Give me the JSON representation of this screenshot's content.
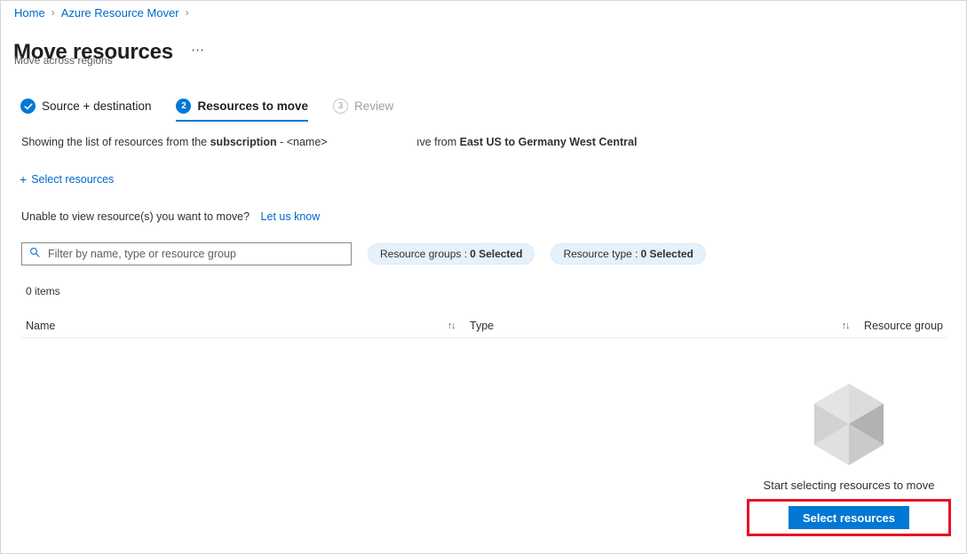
{
  "breadcrumb": {
    "items": [
      {
        "label": "Home"
      },
      {
        "label": "Azure Resource Mover"
      }
    ],
    "separator": "›"
  },
  "header": {
    "title": "Move resources",
    "ellipsis": "⋯",
    "subtitle": "Move across regions"
  },
  "steps": [
    {
      "badge": "✓",
      "label": "Source + destination",
      "state": "done"
    },
    {
      "badge": "2",
      "label": "Resources to move",
      "state": "active"
    },
    {
      "badge": "3",
      "label": "Review",
      "state": "todo"
    }
  ],
  "info": {
    "prefix": "Showing the list of resources from the ",
    "bold_subscription": "subscription",
    "suffix": " - <name>",
    "right_prefix": "ıve from ",
    "right_bold": "East US to Germany West Central"
  },
  "commands": {
    "select_resources_plus": "+",
    "select_resources_label": "Select resources"
  },
  "unable": {
    "text": "Unable to view resource(s) you want to move?",
    "link": "Let us know"
  },
  "filters": {
    "search_placeholder": "Filter by name, type or resource group",
    "search_value": "",
    "pills": [
      {
        "label": "Resource groups :",
        "value": "0 Selected"
      },
      {
        "label": "Resource type :",
        "value": "0 Selected"
      }
    ]
  },
  "table": {
    "items_count": "0 items",
    "columns": [
      {
        "label": "Name",
        "sort": "↑↓"
      },
      {
        "label": "Type",
        "sort": "↑↓"
      },
      {
        "label": "Resource group",
        "sort": ""
      }
    ],
    "rows": []
  },
  "empty_state": {
    "icon": "cube-icon",
    "message": "Start selecting resources to move",
    "button_label": "Select resources"
  },
  "colors": {
    "accent": "#0078d4",
    "link": "#0066cc",
    "highlight_box": "#e81123",
    "pill_bg": "#e5f1fb"
  }
}
